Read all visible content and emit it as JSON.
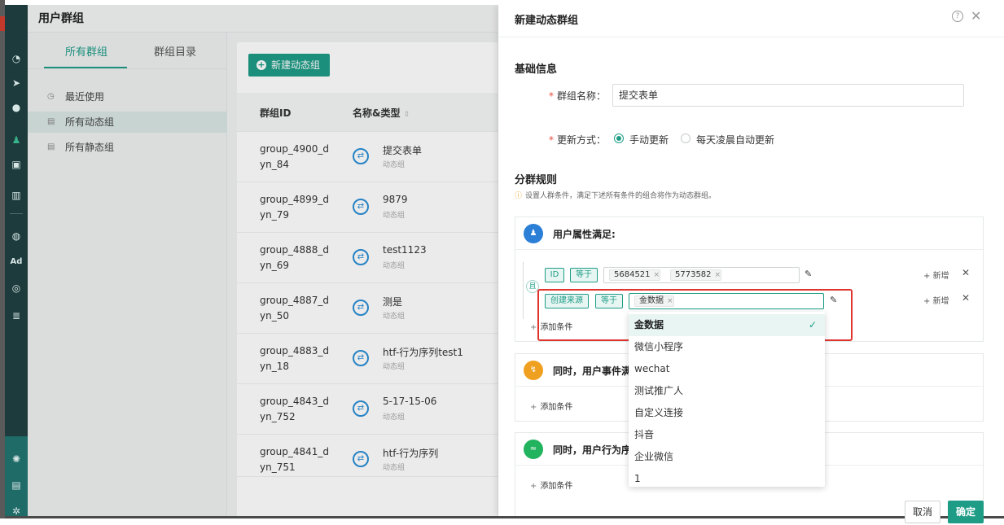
{
  "header": {
    "title": "用户群组"
  },
  "sidebar": {
    "tabs": [
      {
        "label": "所有群组"
      },
      {
        "label": "群组目录"
      }
    ],
    "items": [
      {
        "label": "最近使用"
      },
      {
        "label": "所有动态组"
      },
      {
        "label": "所有静态组"
      }
    ]
  },
  "rail": {
    "ad_label": "Ad"
  },
  "list": {
    "new_button_label": "新建动态组",
    "columns": [
      {
        "label": "群组ID"
      },
      {
        "label": "名称&类型"
      }
    ],
    "rows": [
      {
        "id_line1": "group_4900_d",
        "id_line2": "yn_84",
        "name": "提交表单",
        "type": "动态组"
      },
      {
        "id_line1": "group_4899_d",
        "id_line2": "yn_79",
        "name": "9879",
        "type": "动态组"
      },
      {
        "id_line1": "group_4888_d",
        "id_line2": "yn_69",
        "name": "test1123",
        "type": "动态组"
      },
      {
        "id_line1": "group_4887_d",
        "id_line2": "yn_50",
        "name": "测是",
        "type": "动态组"
      },
      {
        "id_line1": "group_4883_d",
        "id_line2": "yn_18",
        "name": "htf-行为序列test1",
        "type": "动态组"
      },
      {
        "id_line1": "group_4843_d",
        "id_line2": "yn_752",
        "name": "5-17-15-06",
        "type": "动态组"
      },
      {
        "id_line1": "group_4841_d",
        "id_line2": "yn_751",
        "name": "htf-行为序列",
        "type": "动态组"
      }
    ]
  },
  "drawer": {
    "title": "新建动态群组",
    "basic_section": "基础信息",
    "name_label": "群组名称：",
    "name_value": "提交表单",
    "update_label": "更新方式：",
    "update_options": [
      {
        "label": "手动更新",
        "selected": true
      },
      {
        "label": "每天凌晨自动更新",
        "selected": false
      }
    ],
    "rules_section": "分群规则",
    "hint": "设置人群条件，满足下述所有条件的组合将作为动态群组。",
    "required_mark": "*",
    "user_attr_card": {
      "title": "用户属性满足:",
      "and_label": "且",
      "conditions": [
        {
          "field": "ID",
          "op": "等于",
          "values": [
            "5684521",
            "5773582"
          ]
        },
        {
          "field": "创建来源",
          "op": "等于",
          "values": [
            "金数据"
          ]
        }
      ],
      "add_label": "新增",
      "add_condition": "添加条件"
    },
    "event_card": {
      "title": "同时，用户事件满",
      "add_condition": "添加条件"
    },
    "behavior_card": {
      "title": "同时，用户行为序",
      "add_condition": "添加条件"
    },
    "dropdown_options": [
      "金数据",
      "微信小程序",
      "wechat",
      "测试推广人",
      "自定义连接",
      "抖音",
      "企业微信",
      "1"
    ],
    "cancel_label": "取消",
    "ok_label": "确定"
  },
  "colors": {
    "accent": "#1e9c86",
    "rail": "#1d3b3c",
    "highlight": "#e0342f"
  }
}
